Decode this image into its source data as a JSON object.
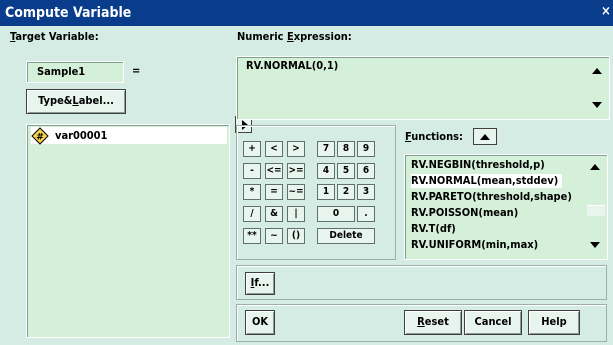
{
  "window": {
    "title": "Compute Variable",
    "close_glyph": "×"
  },
  "target": {
    "label_hotkey": "T",
    "label_rest": "arget Variable:",
    "value": "Sample1",
    "equals": "="
  },
  "type_label_button": {
    "pre": "Type&",
    "hotkey": "L",
    "post": "abel..."
  },
  "variables": [
    {
      "icon": "#",
      "name": "var00001"
    }
  ],
  "expression": {
    "label_pre": "Numeric ",
    "hotkey": "E",
    "label_post": "xpression:",
    "value": "RV.NORMAL(0,1)"
  },
  "keypad": {
    "keys": [
      "+",
      "<",
      ">",
      "7",
      "8",
      "9",
      "-",
      "<=",
      ">=",
      "4",
      "5",
      "6",
      "*",
      "=",
      "~=",
      "1",
      "2",
      "3",
      "/",
      "&",
      "|",
      "0",
      ".",
      "**",
      "~",
      "()",
      "Delete"
    ]
  },
  "functions": {
    "label_hotkey": "F",
    "label_rest": "unctions:",
    "items": [
      "RV.NEGBIN(threshold,p)",
      "RV.NORMAL(mean,stddev)",
      "RV.PARETO(threshold,shape)",
      "RV.POISSON(mean)",
      "RV.T(df)",
      "RV.UNIFORM(min,max)"
    ],
    "selected_index": 1
  },
  "if_button": {
    "hotkey": "I",
    "rest": "f..."
  },
  "buttons": {
    "ok": "OK",
    "reset_hotkey": "R",
    "reset_rest": "eset",
    "cancel": "Cancel",
    "help": "Help"
  },
  "colors": {
    "titlebar": "#0a3c8c",
    "dialog_bg": "#d4ece4",
    "field_bg": "#d4f0d8"
  }
}
